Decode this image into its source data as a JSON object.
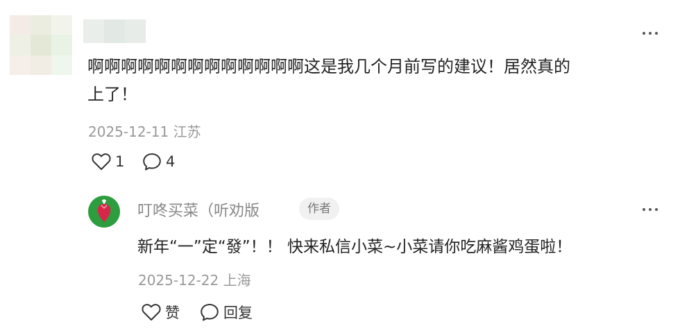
{
  "comment": {
    "text_line1": "啊啊啊啊啊啊啊啊啊啊啊啊啊这是我几个月前写的建议！居然真的",
    "text_line2": "上了！",
    "date": "2025-12-11",
    "location": "江苏",
    "like_count": "1",
    "reply_count": "4"
  },
  "reply": {
    "username": "叮咚买菜（听劝版",
    "badge": "作者",
    "text": "新年“一”定“發”！！ 快来私信小菜~小菜请你吃麻酱鸡蛋啦！",
    "date": "2025-12-22",
    "location": "上海",
    "like_label": "赞",
    "reply_label": "回复"
  },
  "colors": {
    "avatar_bg": "#2e9d3f",
    "radish": "#d8264a",
    "meta": "#999999"
  }
}
